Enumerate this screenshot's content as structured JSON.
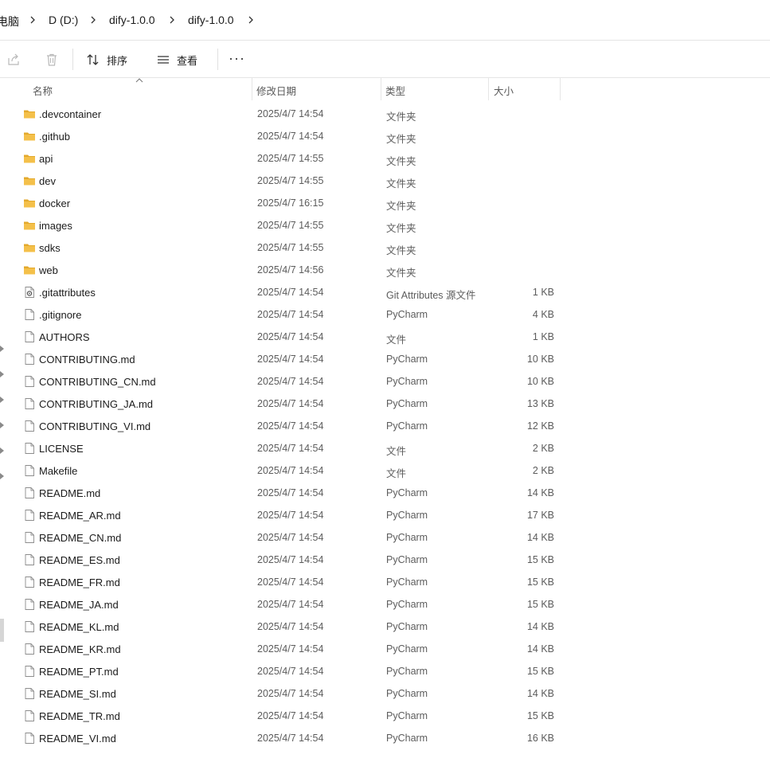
{
  "breadcrumb": [
    "电脑",
    "D (D:)",
    "dify-1.0.0",
    "dify-1.0.0"
  ],
  "toolbar": {
    "share_icon": "share-icon",
    "delete_icon": "trash-icon",
    "sort_label": "排序",
    "view_label": "查看",
    "more_label": "···"
  },
  "columns": {
    "name": "名称",
    "date": "修改日期",
    "type": "类型",
    "size": "大小"
  },
  "files": [
    {
      "name": ".devcontainer",
      "date": "2025/4/7 14:54",
      "type": "文件夹",
      "size": "",
      "icon": "folder-icon"
    },
    {
      "name": ".github",
      "date": "2025/4/7 14:54",
      "type": "文件夹",
      "size": "",
      "icon": "folder-icon"
    },
    {
      "name": "api",
      "date": "2025/4/7 14:55",
      "type": "文件夹",
      "size": "",
      "icon": "folder-icon"
    },
    {
      "name": "dev",
      "date": "2025/4/7 14:55",
      "type": "文件夹",
      "size": "",
      "icon": "folder-icon"
    },
    {
      "name": "docker",
      "date": "2025/4/7 16:15",
      "type": "文件夹",
      "size": "",
      "icon": "folder-icon"
    },
    {
      "name": "images",
      "date": "2025/4/7 14:55",
      "type": "文件夹",
      "size": "",
      "icon": "folder-icon"
    },
    {
      "name": "sdks",
      "date": "2025/4/7 14:55",
      "type": "文件夹",
      "size": "",
      "icon": "folder-icon"
    },
    {
      "name": "web",
      "date": "2025/4/7 14:56",
      "type": "文件夹",
      "size": "",
      "icon": "folder-icon"
    },
    {
      "name": ".gitattributes",
      "date": "2025/4/7 14:54",
      "type": "Git Attributes 源文件",
      "size": "1 KB",
      "icon": "gear-file-icon"
    },
    {
      "name": ".gitignore",
      "date": "2025/4/7 14:54",
      "type": "PyCharm",
      "size": "4 KB",
      "icon": "file-icon"
    },
    {
      "name": "AUTHORS",
      "date": "2025/4/7 14:54",
      "type": "文件",
      "size": "1 KB",
      "icon": "file-icon"
    },
    {
      "name": "CONTRIBUTING.md",
      "date": "2025/4/7 14:54",
      "type": "PyCharm",
      "size": "10 KB",
      "icon": "file-icon"
    },
    {
      "name": "CONTRIBUTING_CN.md",
      "date": "2025/4/7 14:54",
      "type": "PyCharm",
      "size": "10 KB",
      "icon": "file-icon"
    },
    {
      "name": "CONTRIBUTING_JA.md",
      "date": "2025/4/7 14:54",
      "type": "PyCharm",
      "size": "13 KB",
      "icon": "file-icon"
    },
    {
      "name": "CONTRIBUTING_VI.md",
      "date": "2025/4/7 14:54",
      "type": "PyCharm",
      "size": "12 KB",
      "icon": "file-icon"
    },
    {
      "name": "LICENSE",
      "date": "2025/4/7 14:54",
      "type": "文件",
      "size": "2 KB",
      "icon": "file-icon"
    },
    {
      "name": "Makefile",
      "date": "2025/4/7 14:54",
      "type": "文件",
      "size": "2 KB",
      "icon": "file-icon"
    },
    {
      "name": "README.md",
      "date": "2025/4/7 14:54",
      "type": "PyCharm",
      "size": "14 KB",
      "icon": "file-icon"
    },
    {
      "name": "README_AR.md",
      "date": "2025/4/7 14:54",
      "type": "PyCharm",
      "size": "17 KB",
      "icon": "file-icon"
    },
    {
      "name": "README_CN.md",
      "date": "2025/4/7 14:54",
      "type": "PyCharm",
      "size": "14 KB",
      "icon": "file-icon"
    },
    {
      "name": "README_ES.md",
      "date": "2025/4/7 14:54",
      "type": "PyCharm",
      "size": "15 KB",
      "icon": "file-icon"
    },
    {
      "name": "README_FR.md",
      "date": "2025/4/7 14:54",
      "type": "PyCharm",
      "size": "15 KB",
      "icon": "file-icon"
    },
    {
      "name": "README_JA.md",
      "date": "2025/4/7 14:54",
      "type": "PyCharm",
      "size": "15 KB",
      "icon": "file-icon"
    },
    {
      "name": "README_KL.md",
      "date": "2025/4/7 14:54",
      "type": "PyCharm",
      "size": "14 KB",
      "icon": "file-icon"
    },
    {
      "name": "README_KR.md",
      "date": "2025/4/7 14:54",
      "type": "PyCharm",
      "size": "14 KB",
      "icon": "file-icon"
    },
    {
      "name": "README_PT.md",
      "date": "2025/4/7 14:54",
      "type": "PyCharm",
      "size": "15 KB",
      "icon": "file-icon"
    },
    {
      "name": "README_SI.md",
      "date": "2025/4/7 14:54",
      "type": "PyCharm",
      "size": "14 KB",
      "icon": "file-icon"
    },
    {
      "name": "README_TR.md",
      "date": "2025/4/7 14:54",
      "type": "PyCharm",
      "size": "15 KB",
      "icon": "file-icon"
    },
    {
      "name": "README_VI.md",
      "date": "2025/4/7 14:54",
      "type": "PyCharm",
      "size": "16 KB",
      "icon": "file-icon"
    }
  ],
  "colors": {
    "folder": "#f4c04a",
    "folder_dark": "#e3a92c",
    "divider": "#e5e5e5",
    "secondary_text": "#5c5c5c"
  }
}
